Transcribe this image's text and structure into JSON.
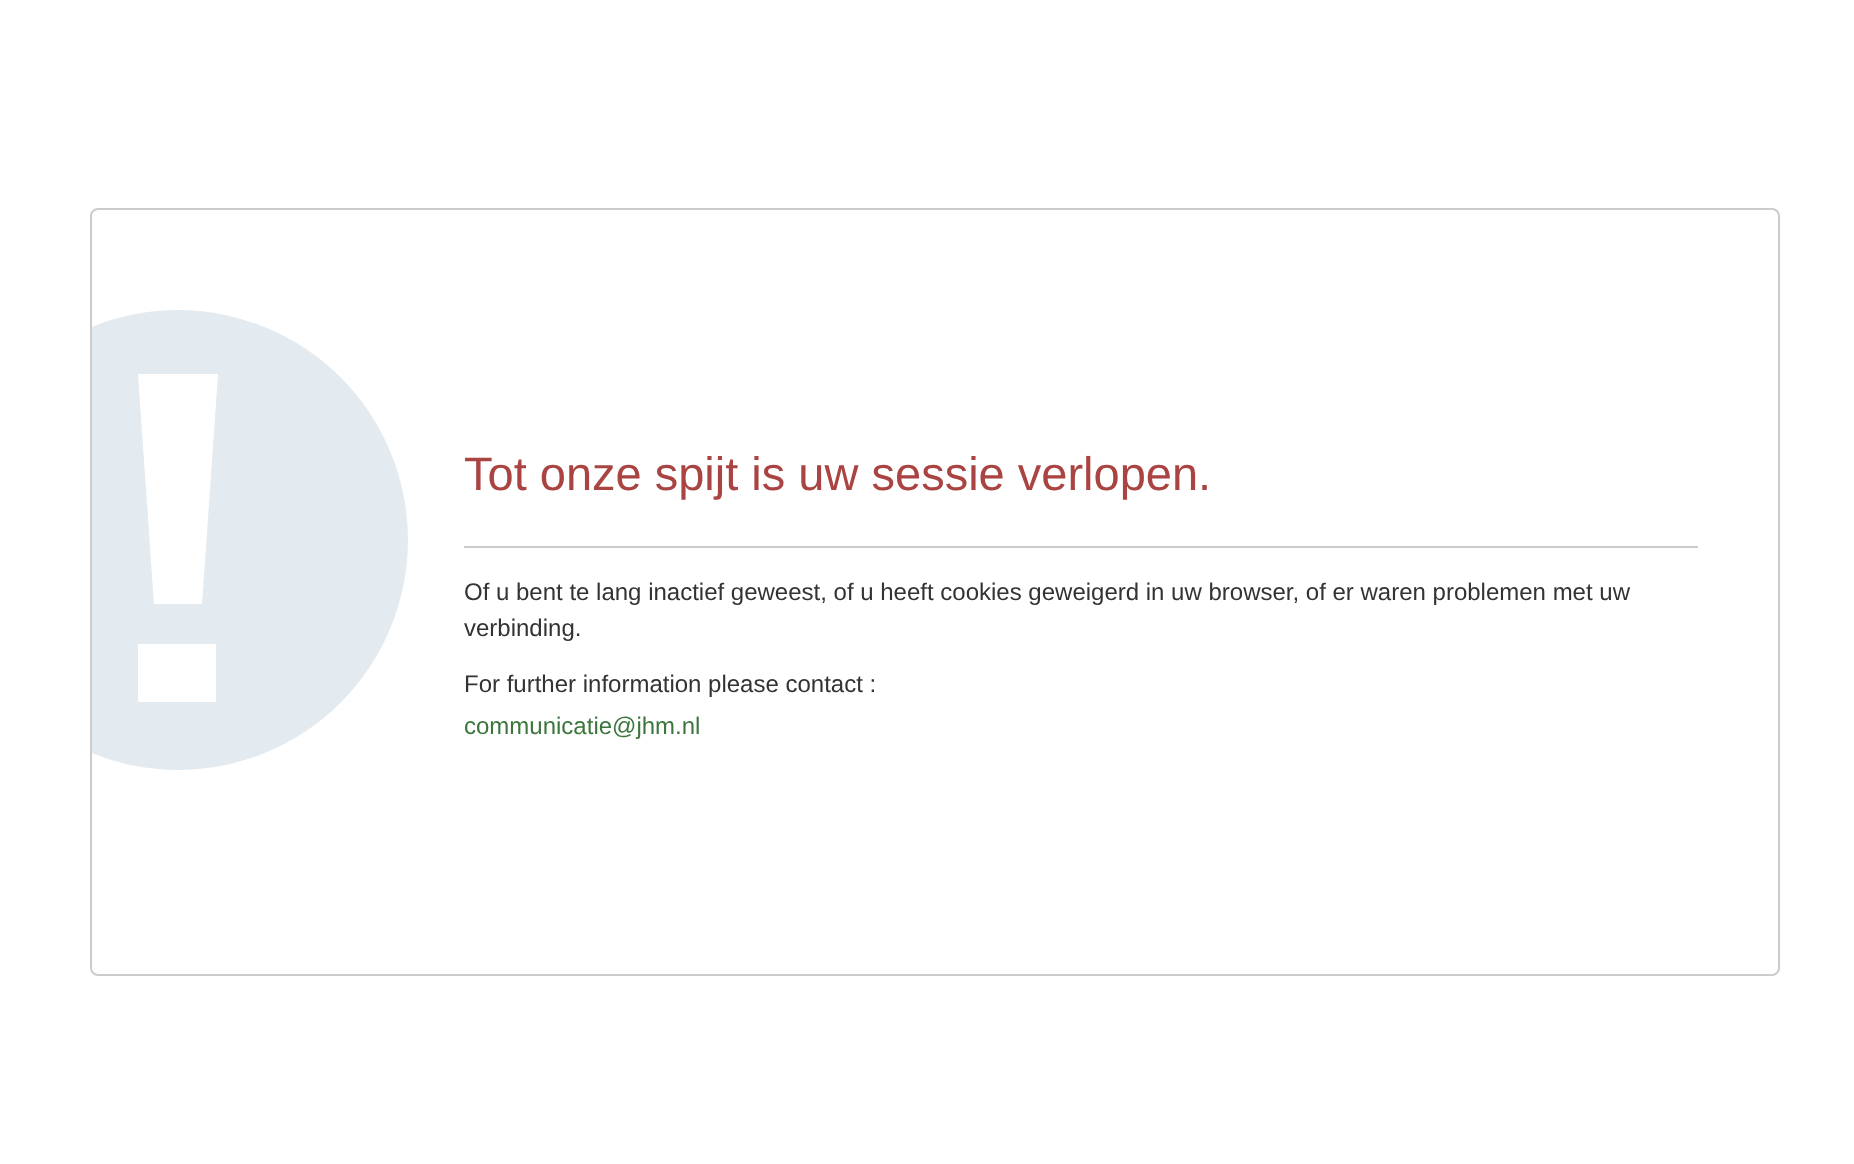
{
  "title": "Tot onze spijt is uw sessie verlopen.",
  "message": "Of u bent te lang inactief geweest, of u heeft cookies geweigerd in uw browser, of er waren problemen met uw verbinding.",
  "contact_label": "For further information please contact :",
  "contact_email": "communicatie@jhm.nl"
}
